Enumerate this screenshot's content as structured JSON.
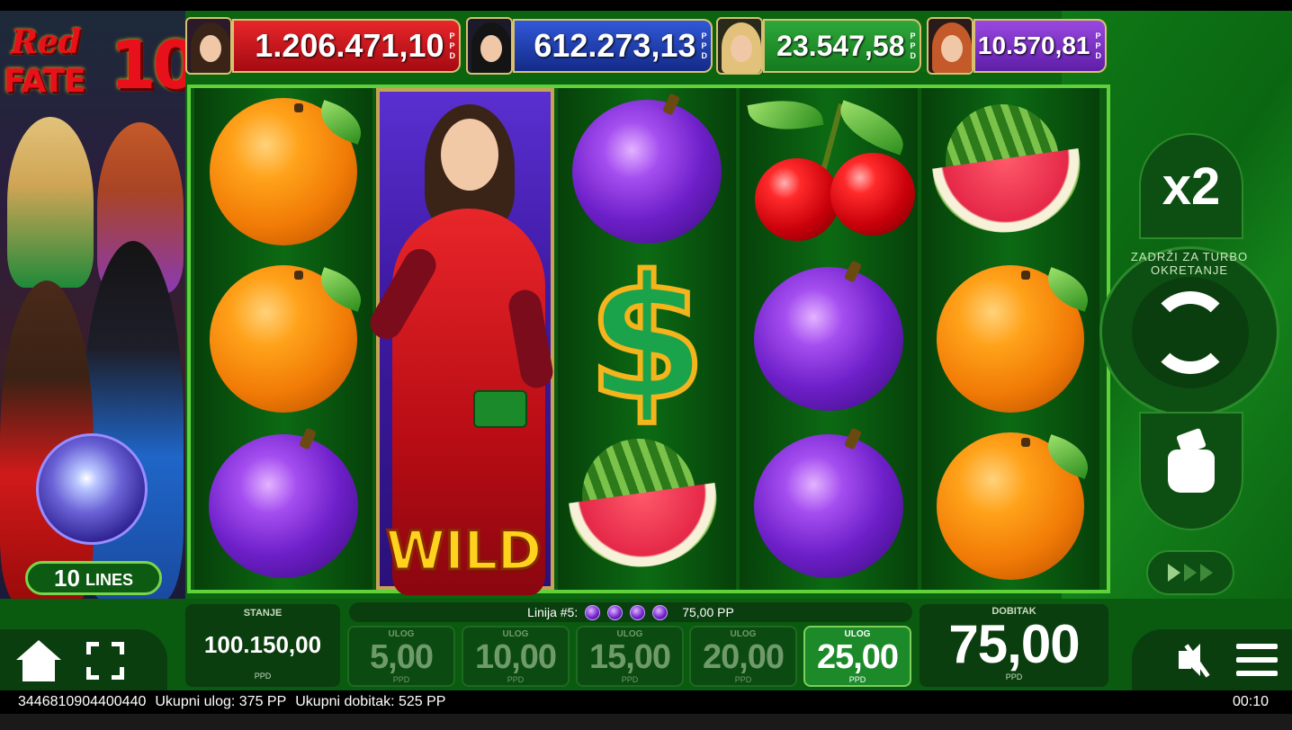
{
  "logo": {
    "line1": "Red",
    "line2": "FATE",
    "number": "10"
  },
  "jackpots": [
    {
      "value": "1.206.471,10",
      "currency": [
        "P",
        "P",
        "D"
      ],
      "color": "#c8141e"
    },
    {
      "value": "612.273,13",
      "currency": [
        "P",
        "P",
        "D"
      ],
      "color": "#1e3ea8"
    },
    {
      "value": "23.547,58",
      "currency": [
        "P",
        "P",
        "D"
      ],
      "color": "#1f8a2a"
    },
    {
      "value": "10.570,81",
      "currency": [
        "P",
        "P",
        "D"
      ],
      "color": "#7a2fc8"
    }
  ],
  "lines_badge": {
    "count": "10",
    "label": "LINES"
  },
  "reels": [
    [
      "orange",
      "orange",
      "plum"
    ],
    [
      "wild",
      "wild",
      "wild"
    ],
    [
      "plum",
      "dollar",
      "watermelon"
    ],
    [
      "cherry",
      "plum",
      "plum"
    ],
    [
      "watermelon",
      "orange",
      "orange"
    ]
  ],
  "wild_label": "WILD",
  "dollar_symbol": "$",
  "controls": {
    "multiplier": "x2",
    "turbo_hint": "ZADRŽI ZA TURBO OKRETANJE"
  },
  "balance": {
    "label": "STANJE",
    "value": "100.150,00",
    "currency": "PPD"
  },
  "line_info": {
    "label": "Linija #5:",
    "amount": "75,00 PP",
    "symbol_count": 4
  },
  "bets": [
    {
      "label": "ULOG",
      "value": "5,00",
      "currency": "PPD",
      "active": false
    },
    {
      "label": "ULOG",
      "value": "10,00",
      "currency": "PPD",
      "active": false
    },
    {
      "label": "ULOG",
      "value": "15,00",
      "currency": "PPD",
      "active": false
    },
    {
      "label": "ULOG",
      "value": "20,00",
      "currency": "PPD",
      "active": false
    },
    {
      "label": "ULOG",
      "value": "25,00",
      "currency": "PPD",
      "active": true
    }
  ],
  "win": {
    "label": "DOBITAK",
    "value": "75,00",
    "currency": "PPD"
  },
  "footer": {
    "round_id": "3446810904400440",
    "total_bet": "Ukupni ulog: 375 PP",
    "total_win": "Ukupni dobitak: 525 PP",
    "time": "00:10"
  },
  "colors": {
    "accent_green": "#5fd13b",
    "panel": "#0b3e0f",
    "bg": "#0a6410"
  }
}
